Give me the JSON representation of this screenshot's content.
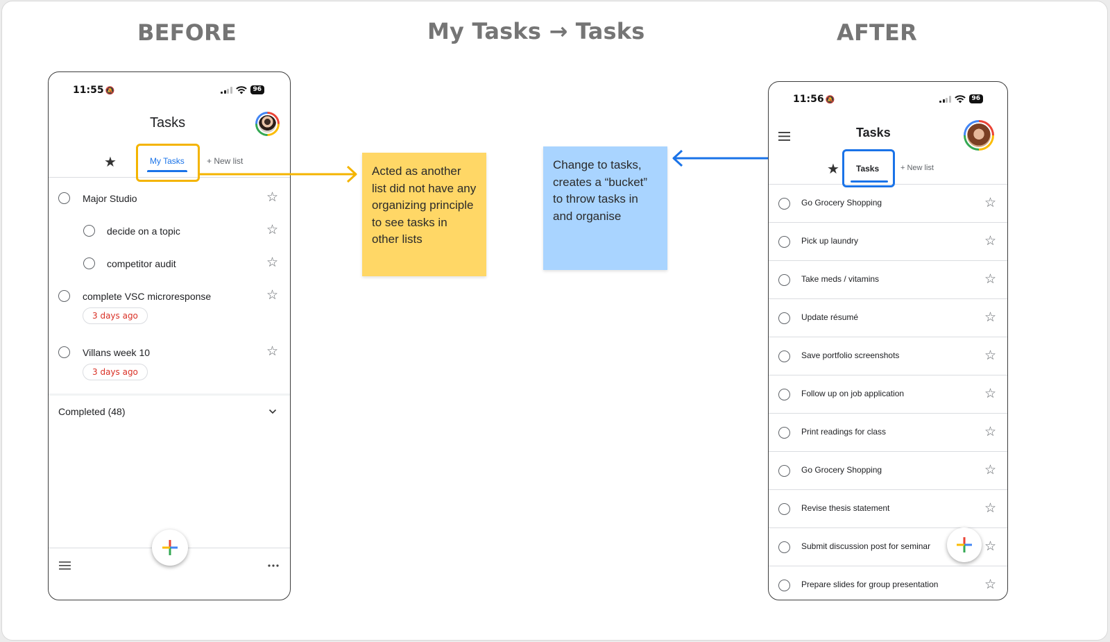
{
  "headings": {
    "before": "BEFORE",
    "center": "My Tasks → Tasks",
    "after": "AFTER"
  },
  "before_phone": {
    "time": "11:55",
    "battery": "96",
    "title": "Tasks",
    "tabs": {
      "active": "My Tasks",
      "new_list": "+ New list"
    },
    "tasks": [
      {
        "label": "Major Studio",
        "level": 0,
        "due": ""
      },
      {
        "label": "decide on a topic",
        "level": 1,
        "due": ""
      },
      {
        "label": "competitor audit",
        "level": 1,
        "due": ""
      },
      {
        "label": "complete VSC microresponse",
        "level": 0,
        "due": "3 days ago"
      },
      {
        "label": "Villans week 10",
        "level": 0,
        "due": "3 days ago"
      }
    ],
    "completed": "Completed (48)",
    "highlight_color": "#f4b400"
  },
  "after_phone": {
    "time": "11:56",
    "battery": "96",
    "title": "Tasks",
    "tabs": {
      "active": "Tasks",
      "new_list": "+ New list"
    },
    "tasks": [
      "Go Grocery Shopping",
      "Pick up laundry",
      "Take meds / vitamins",
      "Update résumé",
      "Save portfolio screenshots",
      "Follow up on job application",
      "Print readings for class",
      "Go Grocery Shopping",
      "Revise thesis statement",
      "Submit discussion post for seminar",
      "Prepare slides for group presentation"
    ],
    "highlight_color": "#1a73e8"
  },
  "notes": {
    "yellow": "Acted as another list did not have any organizing principle to see tasks in other lists",
    "blue": "Change to tasks, creates a “bucket” to throw tasks in and organise"
  },
  "colors": {
    "yellow_note": "#ffd766",
    "blue_note": "#a9d4ff",
    "accent_blue": "#1a73e8",
    "due_red": "#d93025"
  },
  "icons": {
    "star_filled": "★",
    "star_outline": "☆",
    "hamburger": "≡",
    "more": "•••",
    "chevron": "⌄"
  }
}
